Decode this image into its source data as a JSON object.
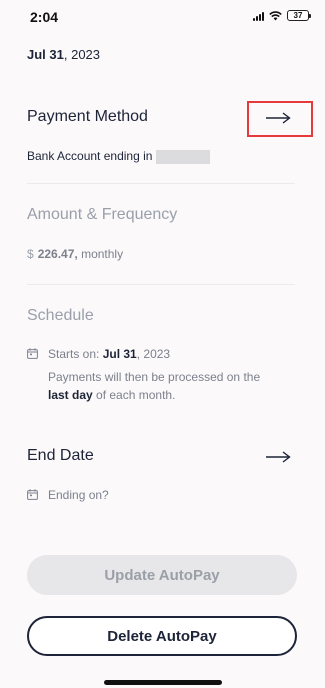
{
  "status_bar": {
    "time": "2:04",
    "battery_level": "37"
  },
  "top_date": {
    "bold": "Jul 31",
    "rest": ", 2023"
  },
  "payment_method": {
    "title": "Payment Method",
    "account_text": "Bank Account ending in"
  },
  "amount_frequency": {
    "title": "Amount & Frequency",
    "currency": "$",
    "amount": "226.47,",
    "frequency": "monthly"
  },
  "schedule": {
    "title": "Schedule",
    "starts_label": "Starts on:",
    "starts_date_bold": "Jul 31",
    "starts_date_rest": ", 2023",
    "note_line1": "Payments will then be processed on the",
    "note_bold": "last day",
    "note_rest": " of each month."
  },
  "end_date": {
    "title": "End Date",
    "ending_label": "Ending on?"
  },
  "buttons": {
    "update": "Update AutoPay",
    "delete": "Delete AutoPay"
  },
  "colors": {
    "text_dark": "#1d2438",
    "text_muted": "#9aa0ab",
    "highlight": "#e5393b"
  }
}
